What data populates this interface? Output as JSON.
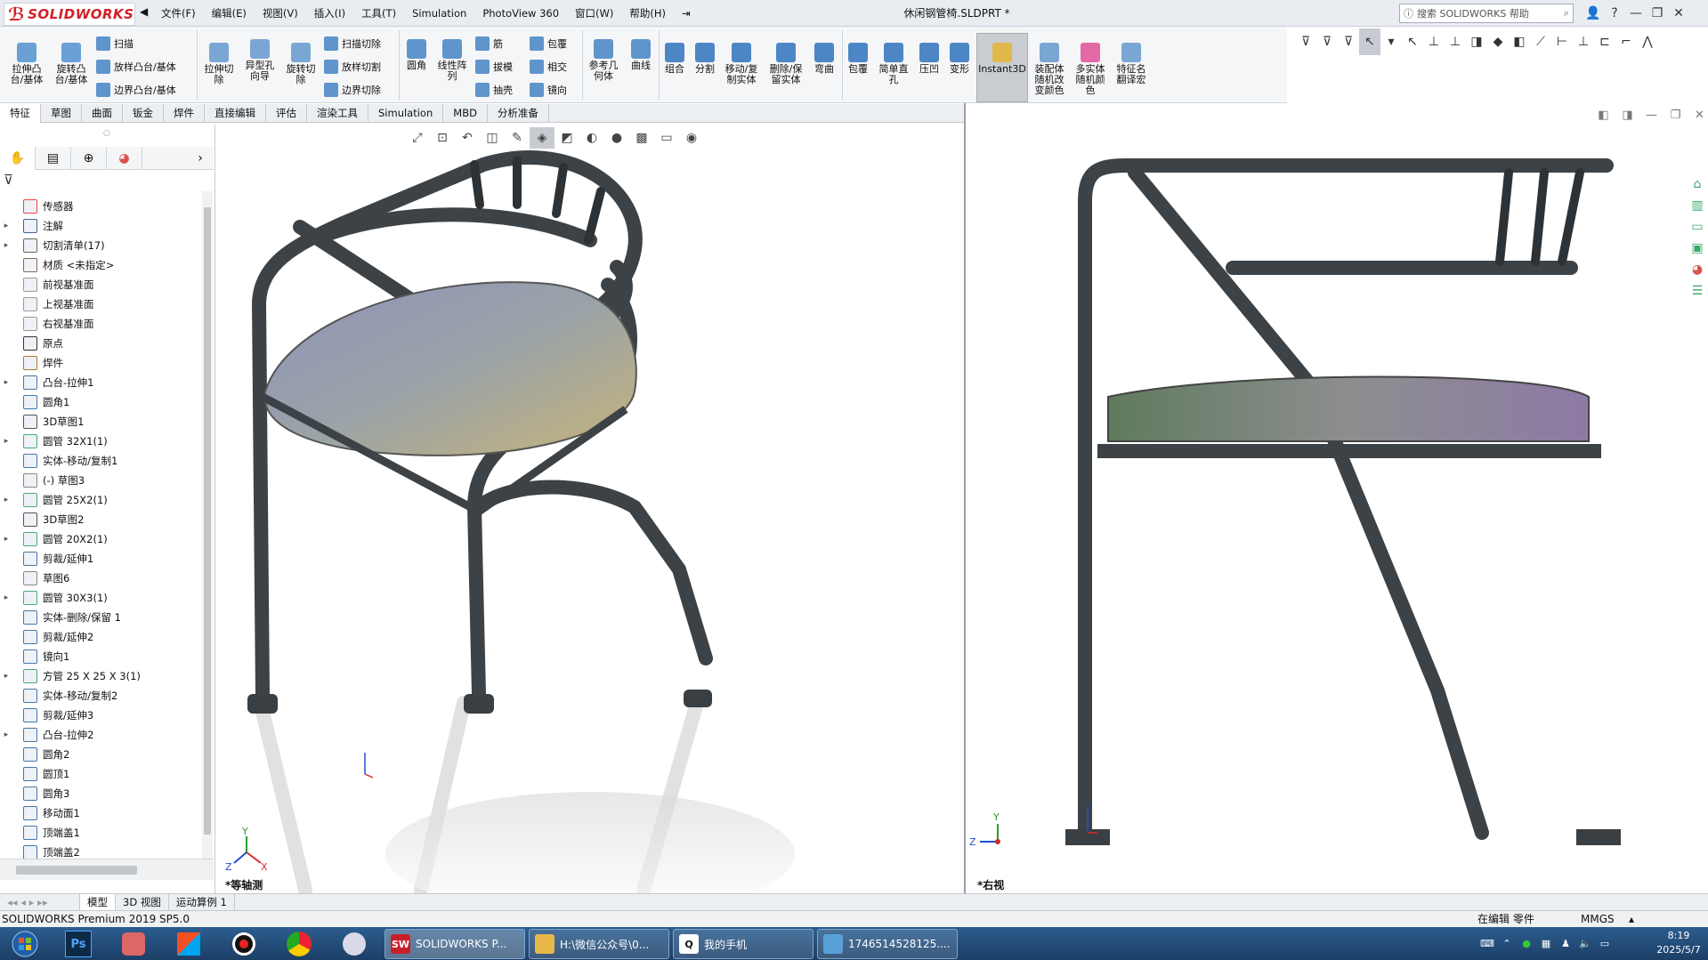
{
  "app": {
    "logo": "SOLIDWORKS",
    "doc_title": "休闲钢管椅.SLDPRT *",
    "search_placeholder": "搜索 SOLIDWORKS 帮助"
  },
  "menu": [
    "文件(F)",
    "编辑(E)",
    "视图(V)",
    "插入(I)",
    "工具(T)",
    "Simulation",
    "PhotoView 360",
    "窗口(W)",
    "帮助(H)"
  ],
  "ribbon": {
    "extrude_boss": "拉伸凸\n台/基体",
    "revolve_boss": "旋转凸\n台/基体",
    "sweep": "扫描",
    "loft_boss": "放样凸台/基体",
    "boundary_boss": "边界凸台/基体",
    "extrude_cut": "拉伸切\n除",
    "hole_wizard": "异型孔\n向导",
    "revolve_cut": "旋转切\n除",
    "sweep_cut": "扫描切除",
    "loft_cut": "放样切割",
    "boundary_cut": "边界切除",
    "fillet": "圆角",
    "linear_pattern": "线性阵\n列",
    "rib": "筋",
    "draft": "拔模",
    "shell": "抽壳",
    "wrap": "包覆",
    "intersect": "相交",
    "mirror": "镜向",
    "ref_geom": "参考几\n何体",
    "curves": "曲线",
    "combine": "组合",
    "split": "分割",
    "move_copy_body": "移动/复\n制实体",
    "delete_keep_body": "删除/保\n留实体",
    "flex": "弯曲",
    "wrap2": "包覆",
    "simple_hole": "简单直\n孔",
    "indent": "压凹",
    "deform": "变形",
    "instant3d": "Instant3D",
    "assembly_color": "装配体\n随机改\n变颜色",
    "multibody_color": "多实体\n随机颜\n色",
    "feature_translate": "特征名\n翻译宏"
  },
  "tabs": [
    "特征",
    "草图",
    "曲面",
    "钣金",
    "焊件",
    "直接编辑",
    "评估",
    "渲染工具",
    "Simulation",
    "MBD",
    "分析准备"
  ],
  "tree": [
    {
      "label": "传感器",
      "exp": false,
      "icon": "sensor-icon"
    },
    {
      "label": "注解",
      "exp": true,
      "icon": "annotation-icon"
    },
    {
      "label": "切割清单(17)",
      "exp": true,
      "icon": "cutlist-icon"
    },
    {
      "label": "材质 <未指定>",
      "exp": false,
      "icon": "material-icon"
    },
    {
      "label": "前视基准面",
      "exp": false,
      "icon": "plane-icon"
    },
    {
      "label": "上视基准面",
      "exp": false,
      "icon": "plane-icon"
    },
    {
      "label": "右视基准面",
      "exp": false,
      "icon": "plane-icon"
    },
    {
      "label": "原点",
      "exp": false,
      "icon": "origin-icon"
    },
    {
      "label": "焊件",
      "exp": false,
      "icon": "weldment-icon"
    },
    {
      "label": "凸台-拉伸1",
      "exp": true,
      "icon": "extrude-icon"
    },
    {
      "label": "圆角1",
      "exp": false,
      "icon": "fillet-icon"
    },
    {
      "label": "3D草图1",
      "exp": false,
      "icon": "sketch3d-icon"
    },
    {
      "label": "圆管 32X1(1)",
      "exp": true,
      "icon": "structural-member-icon"
    },
    {
      "label": "实体-移动/复制1",
      "exp": false,
      "icon": "move-body-icon"
    },
    {
      "label": "(-) 草图3",
      "exp": false,
      "icon": "sketch-icon"
    },
    {
      "label": "圆管 25X2(1)",
      "exp": true,
      "icon": "structural-member-icon"
    },
    {
      "label": "3D草图2",
      "exp": false,
      "icon": "sketch3d-icon"
    },
    {
      "label": "圆管 20X2(1)",
      "exp": true,
      "icon": "structural-member-icon"
    },
    {
      "label": "剪裁/延伸1",
      "exp": false,
      "icon": "trim-icon"
    },
    {
      "label": "草图6",
      "exp": false,
      "icon": "sketch-icon"
    },
    {
      "label": "圆管 30X3(1)",
      "exp": true,
      "icon": "structural-member-icon"
    },
    {
      "label": "实体-删除/保留 1",
      "exp": false,
      "icon": "delete-body-icon"
    },
    {
      "label": "剪裁/延伸2",
      "exp": false,
      "icon": "trim-icon"
    },
    {
      "label": "镜向1",
      "exp": false,
      "icon": "mirror-icon"
    },
    {
      "label": "方管 25 X 25 X 3(1)",
      "exp": true,
      "icon": "structural-member-icon"
    },
    {
      "label": "实体-移动/复制2",
      "exp": false,
      "icon": "move-body-icon"
    },
    {
      "label": "剪裁/延伸3",
      "exp": false,
      "icon": "trim-icon"
    },
    {
      "label": "凸台-拉伸2",
      "exp": true,
      "icon": "extrude-icon"
    },
    {
      "label": "圆角2",
      "exp": false,
      "icon": "fillet-icon"
    },
    {
      "label": "圆顶1",
      "exp": false,
      "icon": "dome-icon"
    },
    {
      "label": "圆角3",
      "exp": false,
      "icon": "fillet-icon"
    },
    {
      "label": "移动面1",
      "exp": false,
      "icon": "move-face-icon"
    },
    {
      "label": "顶端盖1",
      "exp": false,
      "icon": "endcap-icon"
    },
    {
      "label": "顶端盖2",
      "exp": false,
      "icon": "endcap-icon"
    }
  ],
  "viewports": {
    "left_label": "*等轴测",
    "right_label": "*右视"
  },
  "bottom_tabs": [
    "模型",
    "3D 视图",
    "运动算例 1"
  ],
  "status": {
    "product": "SOLIDWORKS Premium 2019 SP5.0",
    "mode": "在编辑 零件",
    "units": "MMGS"
  },
  "taskbar": {
    "tasks": [
      {
        "label": "SOLIDWORKS P...",
        "icon": "solidworks-icon",
        "color": "#c8202a"
      },
      {
        "label": "H:\\微信公众号\\0...",
        "icon": "folder-icon",
        "color": "#e8b84a"
      },
      {
        "label": "我的手机",
        "icon": "qq-icon",
        "color": "#ffffff"
      },
      {
        "label": "1746514528125....",
        "icon": "image-viewer-icon",
        "color": "#5aa0d8"
      }
    ],
    "time": "8:19",
    "date": "2025/5/7"
  }
}
